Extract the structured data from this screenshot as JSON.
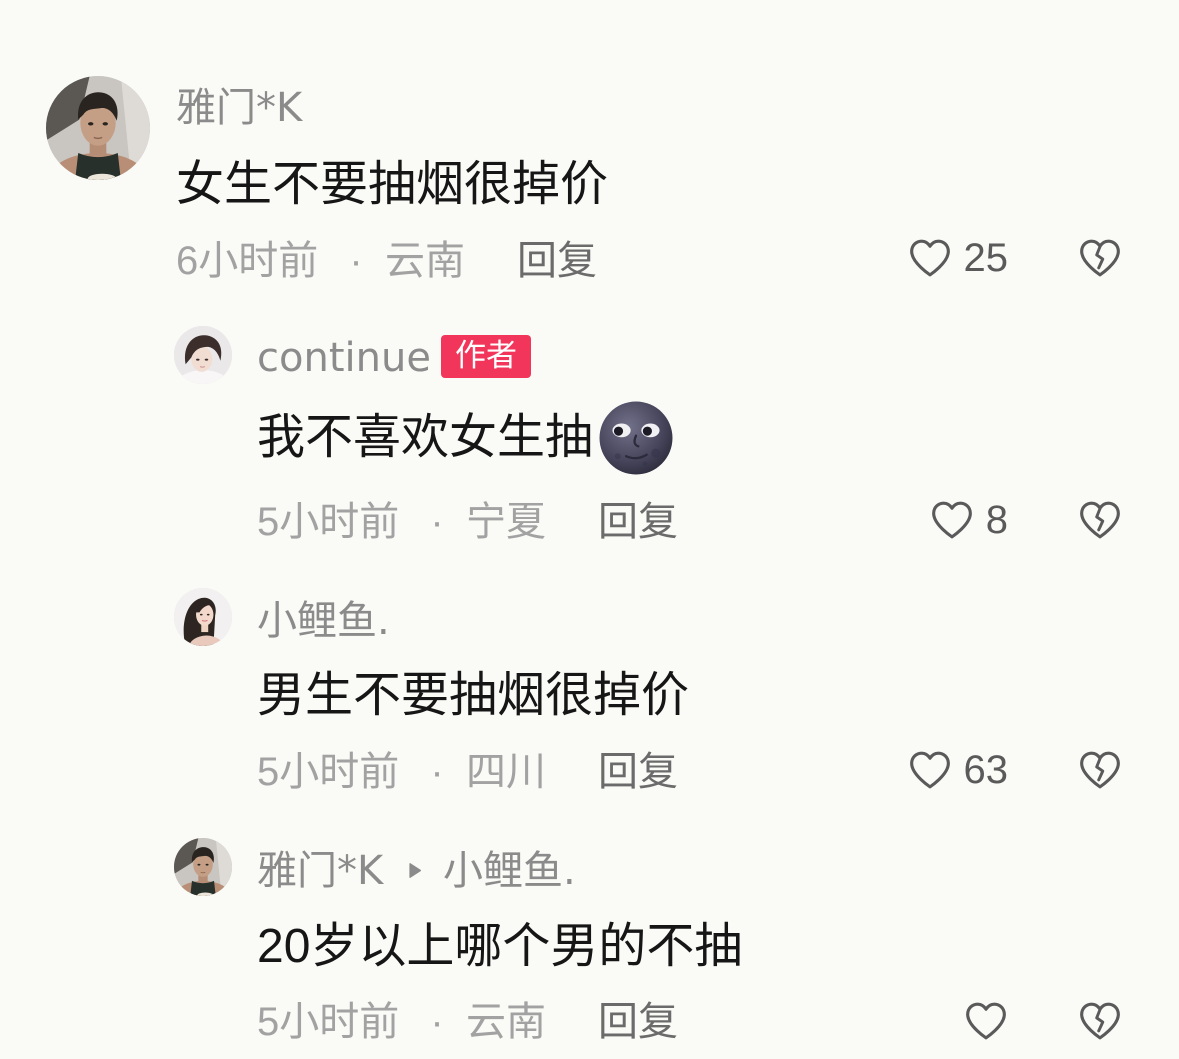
{
  "colors": {
    "background": "#fafaf6",
    "username": "#8b8b8b",
    "text": "#161616",
    "meta": "#a2a2a2",
    "reply": "#6b6b6b",
    "icon": "#5a5a5a",
    "author_badge_bg": "#f2355a",
    "author_badge_text": "#ffffff"
  },
  "icons": {
    "like": "heart-outline-icon",
    "dislike": "broken-heart-icon",
    "reply_to": "triangle-right-icon"
  },
  "meta_separator": "·",
  "comment": {
    "author": "雅门*K",
    "text": "女生不要抽烟很掉价",
    "time": "6小时前",
    "location": "云南",
    "reply_label": "回复",
    "likes": 25
  },
  "replies": [
    {
      "author": "continue",
      "author_badge": "作者",
      "text": "我不喜欢女生抽",
      "emoji": "new-moon-face-emoji",
      "time": "5小时前",
      "location": "宁夏",
      "reply_label": "回复",
      "likes": 8
    },
    {
      "author": "小鲤鱼.",
      "text": "男生不要抽烟很掉价",
      "time": "5小时前",
      "location": "四川",
      "reply_label": "回复",
      "likes": 63
    },
    {
      "author": "雅门*K",
      "reply_to": "小鲤鱼.",
      "text": "20岁以上哪个男的不抽",
      "time": "5小时前",
      "location": "云南",
      "reply_label": "回复"
    }
  ]
}
